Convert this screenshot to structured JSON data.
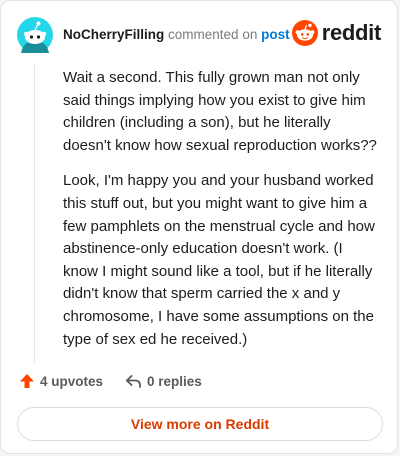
{
  "comment": {
    "username": "NoCherryFilling",
    "action_text": "commented on",
    "link_text": "post",
    "paragraphs": [
      "Wait a second. This fully grown man not only said things implying how you exist to give him children (including a son), but he literally doesn't know how sexual reproduction works??",
      "Look, I'm happy you and your husband worked this stuff out, but you might want to give him a few pamphlets on the menstrual cycle and how abstinence-only education doesn't work. (I know I might sound like a tool, but if he literally didn't know that sperm carried the x and y chromosome, I have some assumptions on the type of sex ed he received.)"
    ]
  },
  "brand": {
    "name": "reddit",
    "icon": "reddit-logo-icon",
    "color": "#ff4500"
  },
  "actions": {
    "upvotes_label": "4 upvotes",
    "replies_label": "0 replies",
    "upvote_icon": "upvote-arrow-icon",
    "reply_icon": "reply-arrow-icon"
  },
  "footer": {
    "view_more_label": "View more on Reddit"
  },
  "colors": {
    "accent": "#d93a00",
    "link": "#0079d3",
    "avatar_bg": "#24d7e8"
  }
}
